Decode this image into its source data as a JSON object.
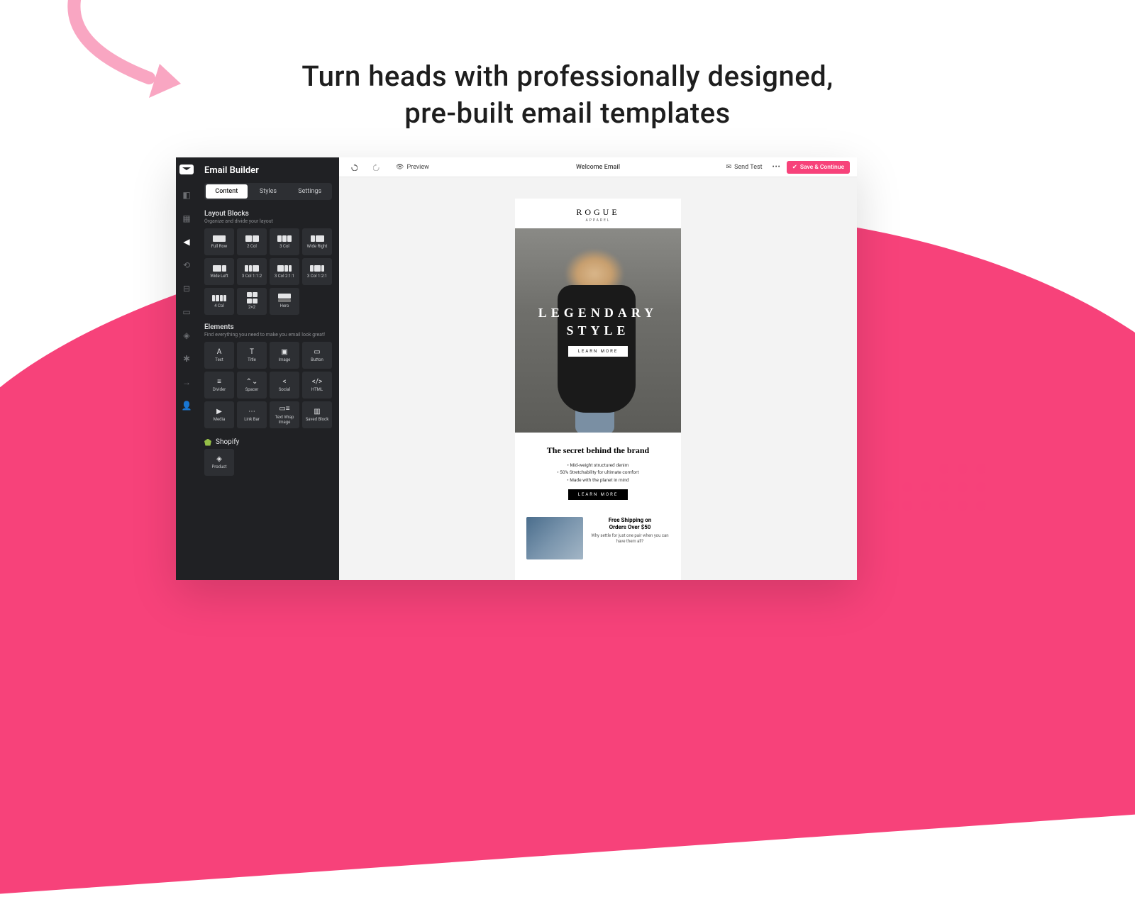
{
  "marketing": {
    "headline_l1": "Turn heads with professionally designed,",
    "headline_l2": "pre-built email templates"
  },
  "sidebar": {
    "title": "Email Builder",
    "tabs": [
      "Content",
      "Styles",
      "Settings"
    ],
    "layout_title": "Layout Blocks",
    "layout_sub": "Organize and divide your layout",
    "layout_blocks": [
      "Full Row",
      "2 Col",
      "3 Col",
      "Wide Right",
      "Wide Left",
      "3 Col 1:1:2",
      "3 Col 2:1:1",
      "3 Col 1:2:1",
      "4 Col",
      "2×2",
      "Hero"
    ],
    "elements_title": "Elements",
    "elements_sub": "Find everything you need to make you email look great!",
    "elements": [
      "Text",
      "Title",
      "Image",
      "Button",
      "Divider",
      "Spacer",
      "Social",
      "HTML",
      "Media",
      "Link Bar",
      "Text Wrap Image",
      "Saved Block"
    ],
    "shopify_label": "Shopify",
    "shopify_blocks": [
      "Product"
    ]
  },
  "topbar": {
    "preview": "Preview",
    "doc_title": "Welcome Email",
    "send_test": "Send Test",
    "save": "Save & Continue"
  },
  "email": {
    "brand": "ROGUE",
    "brand_sub": "APPAREL",
    "hero_l1": "LEGENDARY",
    "hero_l2": "STYLE",
    "hero_cta": "LEARN MORE",
    "secret_title": "The secret behind the brand",
    "secret_points": [
      "Mid-weight structured denim",
      "50% Stretchability for ultimate comfort",
      "Made with the planet in mind"
    ],
    "secret_cta": "LEARN MORE",
    "ship_title_l1": "Free Shipping on",
    "ship_title_l2": "Orders Over $50",
    "ship_copy": "Why settle for just one pair when you can have them all?"
  }
}
